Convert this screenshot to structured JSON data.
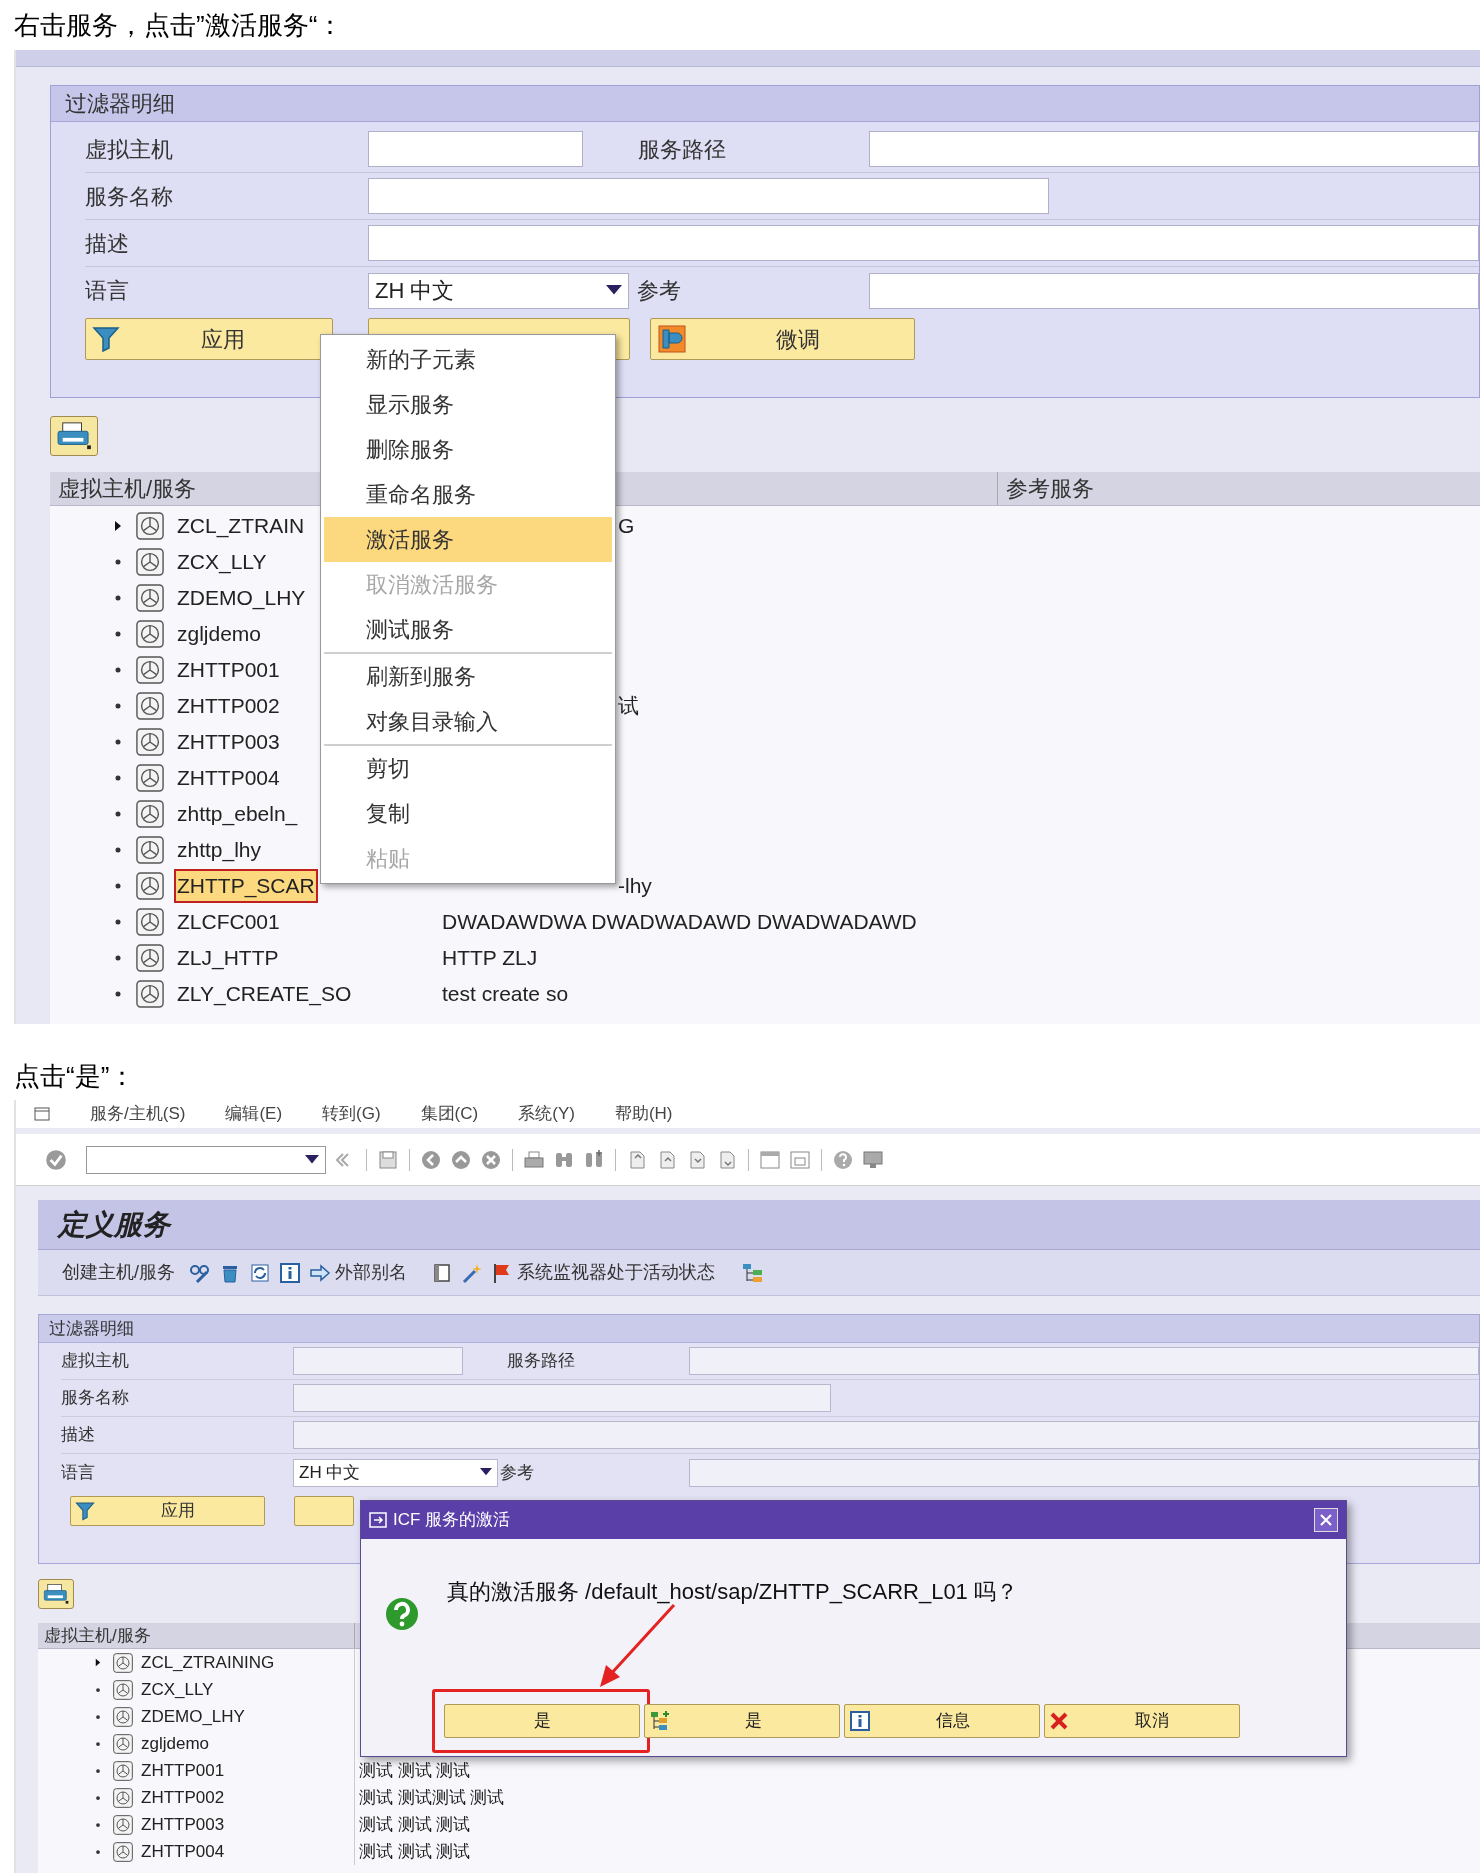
{
  "caption_1": "右击服务，点击”激活服务“：",
  "screen_1": {
    "filter": {
      "title": "过滤器明细",
      "labels": {
        "virtual_host": "虚拟主机",
        "service_path": "服务路径",
        "service_name": "服务名称",
        "description": "描述",
        "language": "语言",
        "reference": "参考"
      },
      "language_value": "ZH 中文",
      "buttons": [
        "应用",
        "微调"
      ]
    },
    "tree": {
      "columns": [
        "虚拟主机/服务",
        "参考服务"
      ],
      "rows": [
        {
          "name": "ZCL_ZTRAIN",
          "description": "G",
          "expandable": true,
          "selected": false
        },
        {
          "name": "ZCX_LLY",
          "expandable": false,
          "selected": false
        },
        {
          "name": "ZDEMO_LHY",
          "expandable": false,
          "selected": false
        },
        {
          "name": "zgljdemo",
          "expandable": false,
          "selected": false
        },
        {
          "name": "ZHTTP001",
          "expandable": false,
          "selected": false
        },
        {
          "name": "ZHTTP002",
          "description": "试",
          "expandable": false,
          "selected": false
        },
        {
          "name": "ZHTTP003",
          "expandable": false,
          "selected": false
        },
        {
          "name": "ZHTTP004",
          "expandable": false,
          "selected": false
        },
        {
          "name": "zhttp_ebeln_",
          "expandable": false,
          "selected": false
        },
        {
          "name": "zhttp_lhy",
          "expandable": false,
          "selected": false
        },
        {
          "name": "ZHTTP_SCAR",
          "description": "-lhy",
          "expandable": false,
          "selected": true
        },
        {
          "name": "ZLCFC001",
          "description": "DWADAWDWA DWADWADAWD DWADWADAWD",
          "expandable": false,
          "selected": false
        },
        {
          "name": "ZLJ_HTTP",
          "description": "HTTP ZLJ",
          "expandable": false,
          "selected": false
        },
        {
          "name": "ZLY_CREATE_SO",
          "description": "test create so",
          "expandable": false,
          "selected": false
        }
      ]
    },
    "context_menu": {
      "groups": [
        [
          {
            "label": "新的子元素",
            "selected": false,
            "disabled": false
          },
          {
            "label": "显示服务",
            "selected": false,
            "disabled": false
          },
          {
            "label": "删除服务",
            "selected": false,
            "disabled": false
          },
          {
            "label": "重命名服务",
            "selected": false,
            "disabled": false
          },
          {
            "label": "激活服务",
            "selected": true,
            "disabled": false
          },
          {
            "label": "取消激活服务",
            "selected": false,
            "disabled": true
          },
          {
            "label": "测试服务",
            "selected": false,
            "disabled": false
          }
        ],
        [
          {
            "label": "刷新到服务",
            "selected": false,
            "disabled": false
          },
          {
            "label": "对象目录输入",
            "selected": false,
            "disabled": false
          }
        ],
        [
          {
            "label": "剪切",
            "selected": false,
            "disabled": false
          },
          {
            "label": "复制",
            "selected": false,
            "disabled": false
          },
          {
            "label": "粘贴",
            "selected": false,
            "disabled": true
          }
        ]
      ]
    }
  },
  "caption_2": "点击“是”：",
  "screen_2": {
    "menu_bar": [
      "服务/主机(S)",
      "编辑(E)",
      "转到(G)",
      "集团(C)",
      "系统(Y)",
      "帮助(H)"
    ],
    "title": "定义服务",
    "app_toolbar": [
      "创建主机/服务",
      "外部别名",
      "系统监视器处于活动状态"
    ],
    "filter": {
      "title": "过滤器明细",
      "labels": {
        "virtual_host": "虚拟主机",
        "service_path": "服务路径",
        "service_name": "服务名称",
        "description": "描述",
        "language": "语言",
        "reference": "参考"
      },
      "language_value": "ZH 中文",
      "buttons": [
        "应用"
      ]
    },
    "tree": {
      "columns": [
        "虚拟主机/服务"
      ],
      "rows": [
        {
          "name": "ZCL_ZTRAINING",
          "expandable": true
        },
        {
          "name": "ZCX_LLY",
          "expandable": false
        },
        {
          "name": "ZDEMO_LHY",
          "expandable": false
        },
        {
          "name": "zgljdemo",
          "expandable": false
        },
        {
          "name": "ZHTTP001",
          "description": "测试 测试 测试",
          "expandable": false
        },
        {
          "name": "ZHTTP002",
          "description": "测试 测试测试 测试",
          "expandable": false
        },
        {
          "name": "ZHTTP003",
          "description": "测试 测试 测试",
          "expandable": false
        },
        {
          "name": "ZHTTP004",
          "description": "测试 测试 测试",
          "expandable": false
        }
      ]
    },
    "dialog": {
      "title": "ICF 服务的激活",
      "message": "真的激活服务 /default_host/sap/ZHTTP_SCARR_L01 吗？",
      "buttons": [
        {
          "label": "是",
          "kind": "plain",
          "selected": true
        },
        {
          "label": "是",
          "kind": "tree",
          "selected": false
        },
        {
          "label": "信息",
          "kind": "info",
          "selected": false
        },
        {
          "label": "取消",
          "kind": "cancel",
          "selected": false
        }
      ]
    }
  }
}
